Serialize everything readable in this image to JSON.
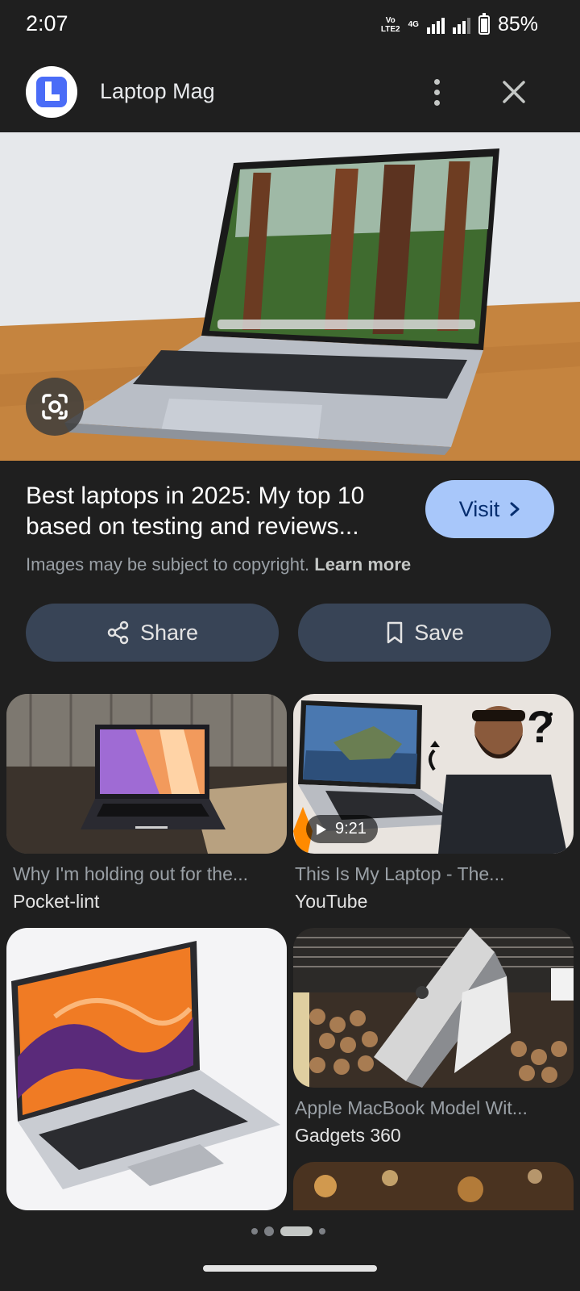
{
  "status_bar": {
    "time": "2:07",
    "network_label": "VoLTE2",
    "network_type": "4G",
    "battery": "85%",
    "battery_level": 0.85
  },
  "header": {
    "site_name": "Laptop Mag",
    "logo_letter": "L",
    "logo_color": "#4a6cf7"
  },
  "result": {
    "title": "Best laptops in 2025: My top 10 based on testing and reviews...",
    "visit_label": "Visit",
    "copyright_text": "Images may be subject to copyright.",
    "learn_more": "Learn more"
  },
  "actions": {
    "share_label": "Share",
    "save_label": "Save"
  },
  "related": [
    {
      "title": "Why I'm holding out for the...",
      "source": "Pocket-lint"
    },
    {
      "title": "This Is My Laptop - The...",
      "source": "YouTube",
      "duration": "9:21"
    },
    {
      "title": "",
      "source": ""
    },
    {
      "title": "Apple MacBook Model Wit...",
      "source": "Gadgets 360"
    }
  ],
  "pagination": {
    "current_index": 2,
    "count": 4
  },
  "colors": {
    "background": "#1f1f1f",
    "visit_button": "#a8c7fa",
    "pill_button": "#384456"
  }
}
